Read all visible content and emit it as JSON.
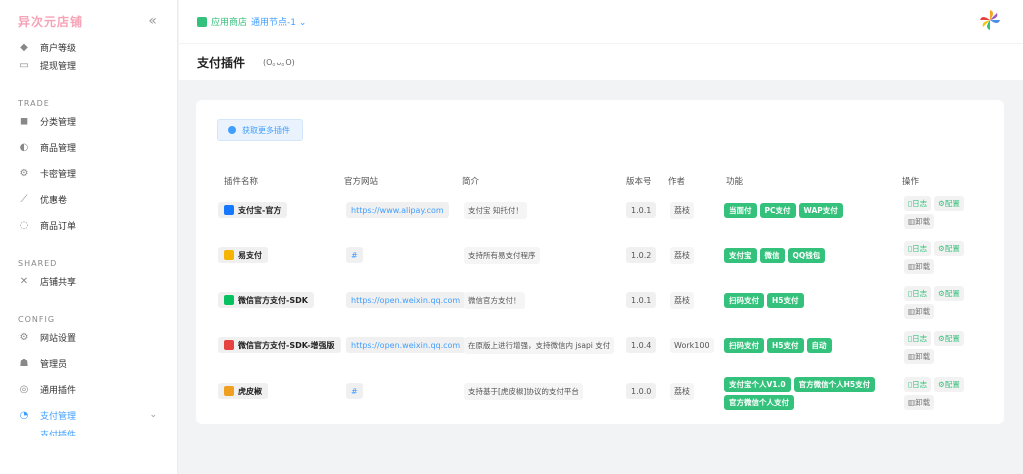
{
  "brand": "异次元店铺",
  "sidebar": {
    "top_items": [
      {
        "label": "商户等级",
        "icon": "tag-icon"
      },
      {
        "label": "提现管理",
        "icon": "wallet-icon"
      }
    ],
    "sections": [
      {
        "title": "TRADE",
        "items": [
          {
            "label": "分类管理",
            "icon": "cube-icon"
          },
          {
            "label": "商品管理",
            "icon": "box-icon"
          },
          {
            "label": "卡密管理",
            "icon": "gear-icon"
          },
          {
            "label": "优惠卷",
            "icon": "ticket-icon"
          },
          {
            "label": "商品订单",
            "icon": "order-icon"
          }
        ]
      },
      {
        "title": "SHARED",
        "items": [
          {
            "label": "店铺共享",
            "icon": "share-icon"
          }
        ]
      },
      {
        "title": "CONFIG",
        "items": [
          {
            "label": "网站设置",
            "icon": "settings-icon"
          },
          {
            "label": "管理员",
            "icon": "admin-icon"
          },
          {
            "label": "通用插件",
            "icon": "plugin-icon"
          },
          {
            "label": "支付管理",
            "icon": "payment-icon"
          }
        ]
      }
    ],
    "bottom_partial": "支付插件"
  },
  "topbar": {
    "store": "应用商店",
    "node": "通用节点-1"
  },
  "page": {
    "title": "支付插件",
    "subtitle": "(O｡ᴗ｡O)"
  },
  "more_button": "获取更多插件",
  "table": {
    "headers": [
      "插件名称",
      "官方网站",
      "简介",
      "版本号",
      "作者",
      "功能",
      "操作"
    ],
    "rows": [
      {
        "name": "支付宝-官方",
        "icon_color": "#1677ff",
        "site": "https://www.alipay.com",
        "desc": "支付宝 知托付！",
        "version": "1.0.1",
        "author": "荔枝",
        "features": [
          "当面付",
          "PC支付",
          "WAP支付"
        ]
      },
      {
        "name": "易支付",
        "icon_color": "#f5b400",
        "site": "#",
        "desc": "支持所有易支付程序",
        "version": "1.0.2",
        "author": "荔枝",
        "features": [
          "支付宝",
          "微信",
          "QQ钱包"
        ]
      },
      {
        "name": "微信官方支付-SDK",
        "icon_color": "#07c160",
        "site": "https://open.weixin.qq.com",
        "desc": "微信官方支付！",
        "version": "1.0.1",
        "author": "荔枝",
        "features": [
          "扫码支付",
          "H5支付"
        ]
      },
      {
        "name": "微信官方支付-SDK-增强版",
        "icon_color": "#e64340",
        "site": "https://open.weixin.qq.com",
        "desc": "在原版上进行增强，支持微信内 jsapi 支付",
        "version": "1.0.4",
        "author": "Work100",
        "features": [
          "扫码支付",
          "H5支付",
          "自动"
        ]
      },
      {
        "name": "虎皮椒",
        "icon_color": "#f0a020",
        "site": "#",
        "desc": "支持基于[虎皮椒]协议的支付平台",
        "version": "1.0.0",
        "author": "荔枝",
        "features": [
          "支付宝个人V1.0",
          "官方微信个人H5支付",
          "官方微信个人支付"
        ]
      }
    ],
    "ops": {
      "log": "日志",
      "config": "配置",
      "uninstall": "卸载"
    }
  },
  "colors": {
    "accent": "#409eff",
    "success": "#34c17b",
    "brand": "#f5a3b6"
  }
}
